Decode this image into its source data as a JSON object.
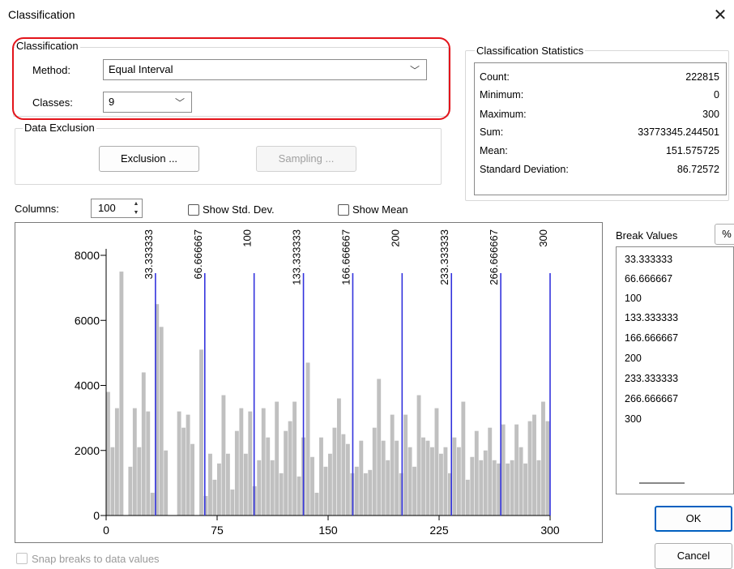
{
  "window": {
    "title": "Classification",
    "close_glyph": "✕"
  },
  "classification_group": {
    "legend": "Classification",
    "method_label": "Method:",
    "method_value": "Equal Interval",
    "classes_label": "Classes:",
    "classes_value": "9",
    "highlight_color": "#e3141b"
  },
  "exclusion_group": {
    "legend": "Data Exclusion",
    "exclusion_button": "Exclusion ...",
    "sampling_button": "Sampling ..."
  },
  "stats_group": {
    "legend": "Classification Statistics",
    "rows": [
      {
        "label": "Count:",
        "value": "222815"
      },
      {
        "label": "Minimum:",
        "value": "0"
      },
      {
        "label": "Maximum:",
        "value": "300"
      },
      {
        "label": "Sum:",
        "value": "33773345.244501"
      },
      {
        "label": "Mean:",
        "value": "151.575725"
      },
      {
        "label": "Standard Deviation:",
        "value": "86.72572"
      }
    ]
  },
  "controls": {
    "columns_label": "Columns:",
    "columns_value": "100",
    "show_std_dev": "Show Std. Dev.",
    "show_mean": "Show Mean",
    "snap_breaks": "Snap breaks to data values"
  },
  "break_values": {
    "header": "Break Values",
    "unit_button": "%",
    "items": [
      "33.333333",
      "66.666667",
      "100",
      "133.333333",
      "166.666667",
      "200",
      "233.333333",
      "266.666667",
      "300"
    ]
  },
  "buttons": {
    "ok": "OK",
    "cancel": "Cancel"
  },
  "chart_data": {
    "type": "bar",
    "x_range": [
      0,
      300
    ],
    "y_range": [
      0,
      8000
    ],
    "x_ticks": [
      "0",
      "75",
      "150",
      "225",
      "300"
    ],
    "y_ticks": [
      "0",
      "2000",
      "4000",
      "6000",
      "8000"
    ],
    "bar_color": "#c0c0c0",
    "break_line_color": "#3333dd",
    "break_positions": [
      33.333333,
      66.666667,
      100,
      133.333333,
      166.666667,
      200,
      233.333333,
      266.666667,
      300
    ],
    "break_labels": [
      "33.333333",
      "66.666667",
      "100",
      "133.333333",
      "166.666667",
      "200",
      "233.333333",
      "266.666667",
      "300"
    ],
    "values": [
      3800,
      2100,
      3300,
      7500,
      0,
      1500,
      3300,
      2100,
      4400,
      3200,
      700,
      6500,
      5800,
      2000,
      0,
      0,
      3200,
      2700,
      3100,
      2200,
      0,
      5100,
      600,
      1900,
      1100,
      1600,
      3700,
      1900,
      800,
      2600,
      3300,
      1900,
      3200,
      900,
      1700,
      3300,
      2400,
      1700,
      3500,
      1300,
      2600,
      2900,
      3500,
      1200,
      2400,
      4700,
      1800,
      700,
      2400,
      1500,
      1900,
      2700,
      3600,
      2500,
      2200,
      1300,
      1500,
      2300,
      1300,
      1400,
      2700,
      4200,
      2300,
      1700,
      3100,
      2300,
      1300,
      3100,
      2100,
      1500,
      3700,
      2400,
      2300,
      2100,
      3300,
      1900,
      2100,
      1300,
      2400,
      2100,
      3500,
      1100,
      1800,
      2600,
      1700,
      2000,
      2700,
      1700,
      1600,
      2800,
      1600,
      1700,
      2800,
      2100,
      1600,
      2900,
      3100,
      1700,
      3500,
      2900
    ]
  }
}
